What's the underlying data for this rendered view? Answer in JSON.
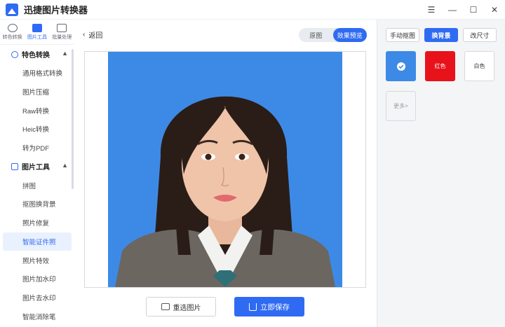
{
  "app": {
    "title": "迅捷图片转换器"
  },
  "window": {
    "menu_icon": "menu-icon",
    "minimize_icon": "minimize-icon",
    "maximize_icon": "maximize-icon",
    "close_icon": "close-icon"
  },
  "top_icons": [
    {
      "label": "转色转换",
      "icon": "convert-icon"
    },
    {
      "label": "图片工具",
      "icon": "image-tools-icon"
    },
    {
      "label": "批量处理",
      "icon": "batch-icon"
    }
  ],
  "sidebar": {
    "section1": {
      "title": "特色转换",
      "items": [
        "通用格式转换",
        "图片压缩",
        "Raw转换",
        "Heic转换",
        "转为PDF"
      ]
    },
    "section2": {
      "title": "图片工具",
      "items": [
        "拼图",
        "抠图换背景",
        "照片修复",
        "智能证件照",
        "照片特效",
        "图片加水印",
        "图片去水印",
        "智能消除笔"
      ]
    },
    "active_item": "智能证件照"
  },
  "main": {
    "back_label": "返回",
    "toggle": {
      "original": "原图",
      "preview": "效果预览"
    },
    "reselect_label": "重选图片",
    "save_label": "立即保存"
  },
  "right": {
    "tabs": [
      "手动抠图",
      "换背景",
      "改尺寸"
    ],
    "active_tab": "换背景",
    "swatches": [
      {
        "label": "",
        "color": "#3d8ae6",
        "selected": true
      },
      {
        "label": "红色",
        "color": "#e8121b",
        "selected": false
      },
      {
        "label": "白色",
        "color": "#ffffff",
        "selected": false
      }
    ],
    "more_label": "更多>"
  },
  "colors": {
    "accent": "#2f6bf2",
    "photo_bg": "#3d8ae6"
  }
}
